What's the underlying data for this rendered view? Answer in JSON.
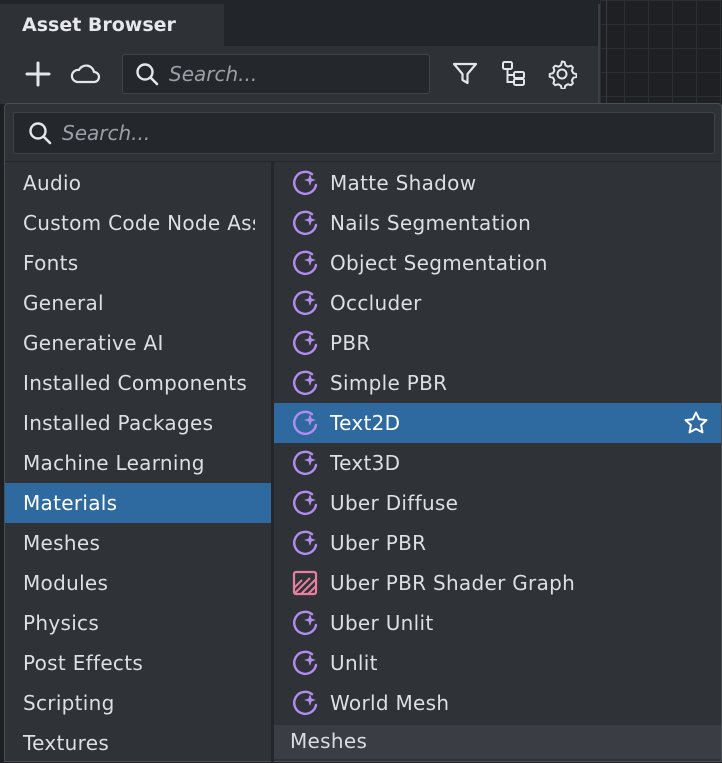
{
  "panel": {
    "tab_title": "Asset Browser",
    "search_placeholder": "Search...",
    "toolbar_icons": [
      "plus-icon",
      "cloud-icon",
      "filter-icon",
      "hierarchy-icon",
      "gear-icon"
    ]
  },
  "popup": {
    "search_placeholder": "Search...",
    "categories": [
      {
        "label": "Audio"
      },
      {
        "label": "Custom Code Node Assets"
      },
      {
        "label": "Fonts"
      },
      {
        "label": "General"
      },
      {
        "label": "Generative AI"
      },
      {
        "label": "Installed Components"
      },
      {
        "label": "Installed Packages"
      },
      {
        "label": "Machine Learning"
      },
      {
        "label": "Materials",
        "selected": true
      },
      {
        "label": "Meshes"
      },
      {
        "label": "Modules"
      },
      {
        "label": "Physics"
      },
      {
        "label": "Post Effects"
      },
      {
        "label": "Scripting"
      },
      {
        "label": "Textures"
      }
    ],
    "materials": [
      {
        "label": "Matte Shadow",
        "icon": "material-sparkle-icon"
      },
      {
        "label": "Nails Segmentation",
        "icon": "material-sparkle-icon"
      },
      {
        "label": "Object Segmentation",
        "icon": "material-sparkle-icon"
      },
      {
        "label": "Occluder",
        "icon": "material-sparkle-icon"
      },
      {
        "label": "PBR",
        "icon": "material-sparkle-icon"
      },
      {
        "label": "Simple PBR",
        "icon": "material-sparkle-icon"
      },
      {
        "label": "Text2D",
        "icon": "material-sparkle-icon",
        "selected": true,
        "favorite_icon": "star-icon"
      },
      {
        "label": "Text3D",
        "icon": "material-sparkle-icon"
      },
      {
        "label": "Uber Diffuse",
        "icon": "material-sparkle-icon"
      },
      {
        "label": "Uber PBR",
        "icon": "material-sparkle-icon"
      },
      {
        "label": "Uber PBR Shader Graph",
        "icon": "shader-graph-icon"
      },
      {
        "label": "Uber Unlit",
        "icon": "material-sparkle-icon"
      },
      {
        "label": "Unlit",
        "icon": "material-sparkle-icon"
      },
      {
        "label": "World Mesh",
        "icon": "material-sparkle-icon"
      }
    ],
    "next_section": "Meshes"
  },
  "colors": {
    "selection": "#2e6aa0",
    "material_icon": "#b48cf0",
    "shader_graph_icon": "#e87ea0"
  }
}
